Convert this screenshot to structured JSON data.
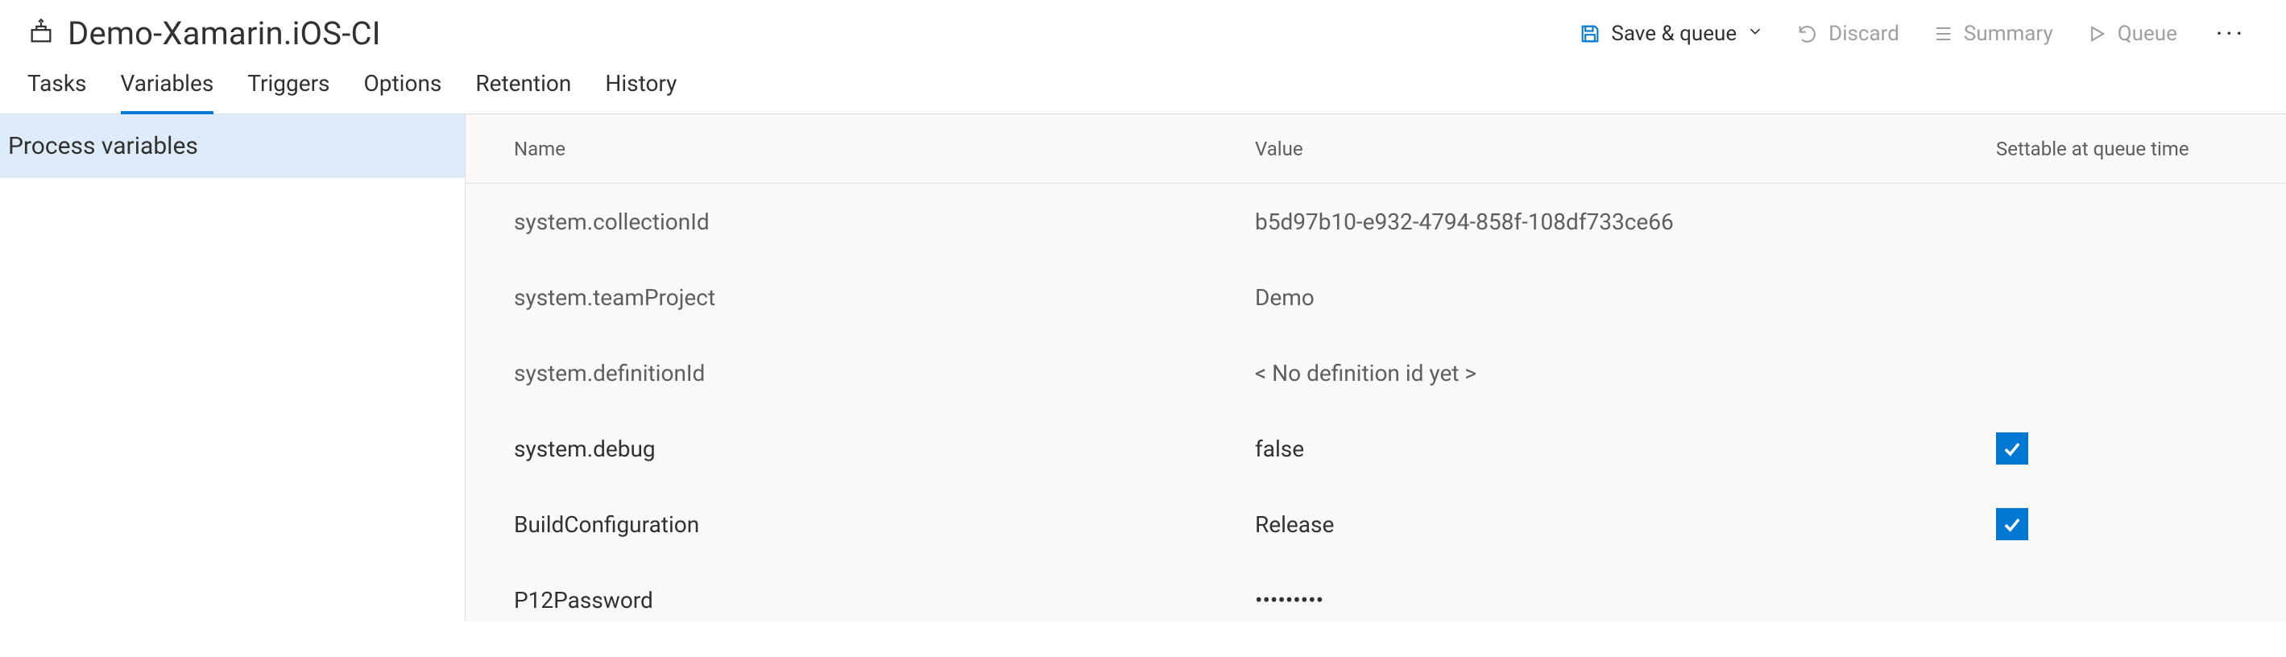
{
  "header": {
    "title": "Demo-Xamarin.iOS-CI",
    "commands": {
      "save_queue": "Save & queue",
      "discard": "Discard",
      "summary": "Summary",
      "queue": "Queue"
    }
  },
  "tabs": {
    "items": [
      {
        "label": "Tasks"
      },
      {
        "label": "Variables"
      },
      {
        "label": "Triggers"
      },
      {
        "label": "Options"
      },
      {
        "label": "Retention"
      },
      {
        "label": "History"
      }
    ],
    "active_index": 1
  },
  "sidebar": {
    "items": [
      {
        "label": "Process variables"
      }
    ],
    "active_index": 0
  },
  "grid": {
    "columns": {
      "name": "Name",
      "value": "Value",
      "settable": "Settable at queue time"
    },
    "rows": [
      {
        "name": "system.collectionId",
        "value": "b5d97b10-e932-4794-858f-108df733ce66",
        "settable": false,
        "system": true
      },
      {
        "name": "system.teamProject",
        "value": "Demo",
        "settable": false,
        "system": true
      },
      {
        "name": "system.definitionId",
        "value": "< No definition id yet >",
        "settable": false,
        "system": true
      },
      {
        "name": "system.debug",
        "value": "false",
        "settable": true,
        "system": false
      },
      {
        "name": "BuildConfiguration",
        "value": "Release",
        "settable": true,
        "system": false
      },
      {
        "name": "P12Password",
        "value": "•••••••••",
        "settable": false,
        "system": false
      }
    ]
  }
}
